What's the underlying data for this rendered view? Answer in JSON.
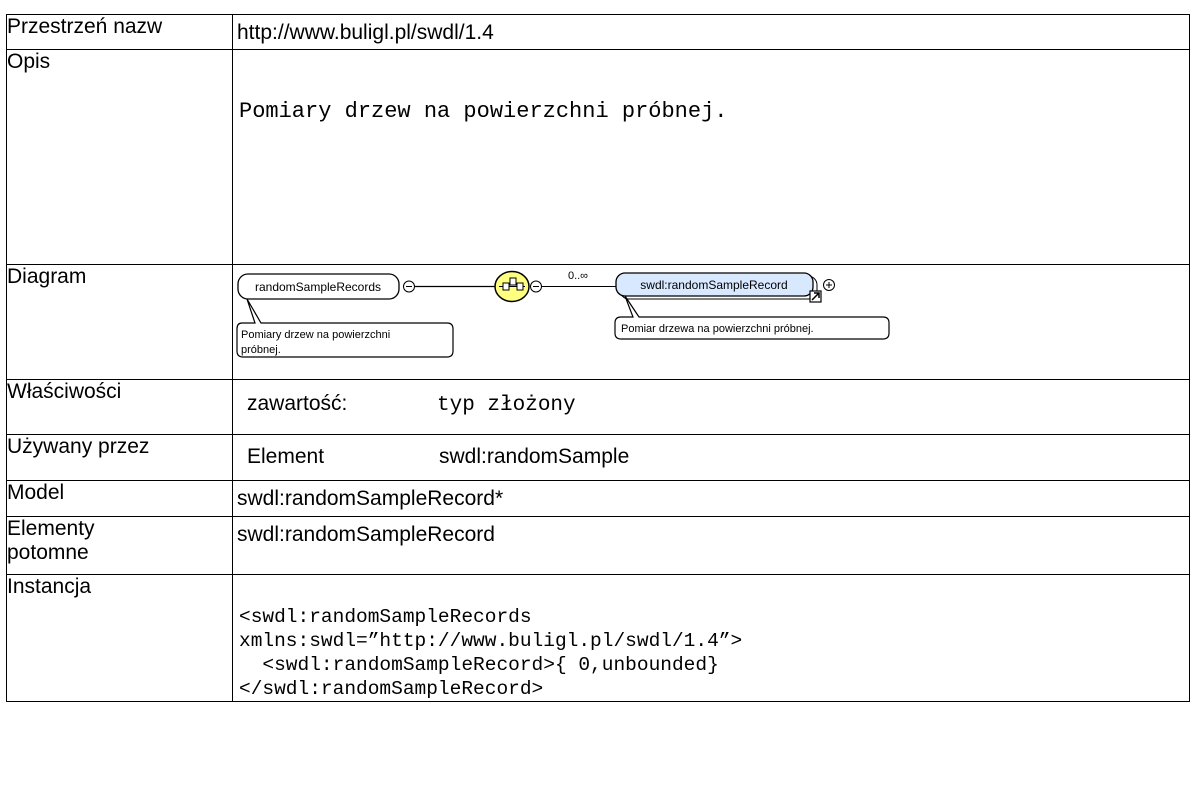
{
  "rows": {
    "namespace": {
      "label": "Przestrzeń nazw",
      "value": "http://www.buligl.pl/swdl/1.4"
    },
    "description": {
      "label": "Opis",
      "value": "Pomiary drzew na powierzchni próbnej."
    },
    "diagram": {
      "label": "Diagram",
      "root_element": "randomSampleRecords",
      "root_annotation_line1": "Pomiary drzew na powierzchni",
      "root_annotation_line2": "próbnej.",
      "multiplicity": "0..∞",
      "child_element": "swdl:randomSampleRecord",
      "child_annotation": "Pomiar drzewa na powierzchni próbnej."
    },
    "properties": {
      "label": "Właściwości",
      "key": "zawartość:",
      "value": "typ złożony"
    },
    "used_by": {
      "label": "Używany przez",
      "key": "Element",
      "value": "swdl:randomSample"
    },
    "model": {
      "label": "Model",
      "value": "swdl:randomSampleRecord*"
    },
    "children": {
      "label_line1": "Elementy",
      "label_line2": "potomne",
      "value": "swdl:randomSampleRecord"
    },
    "instance": {
      "label": "Instancja",
      "lines": [
        "<swdl:randomSampleRecords",
        "xmlns:swdl=”http://www.buligl.pl/swdl/1.4”>",
        "  <swdl:randomSampleRecord>{ 0,unbounded}",
        "</swdl:randomSampleRecord>"
      ]
    }
  }
}
